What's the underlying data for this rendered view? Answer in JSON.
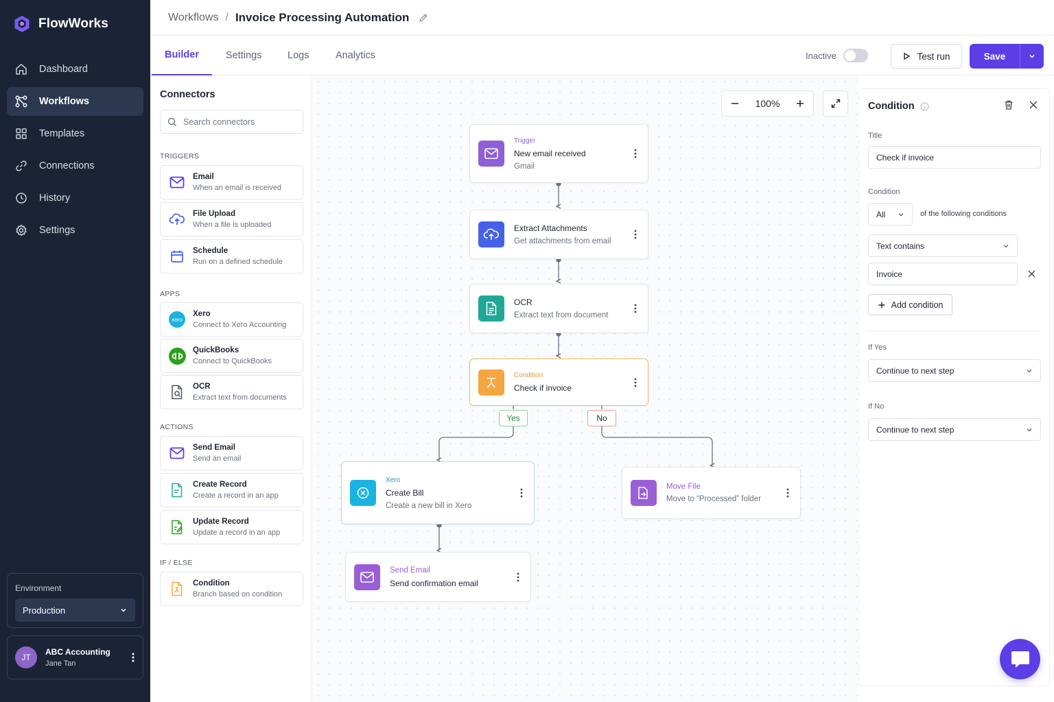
{
  "app": {
    "name": "FlowWorks"
  },
  "sidebar": {
    "items": [
      {
        "label": "Dashboard",
        "icon": "home-icon"
      },
      {
        "label": "Workflows",
        "icon": "workflow-icon",
        "active": true
      },
      {
        "label": "Templates",
        "icon": "grid-icon"
      },
      {
        "label": "Connections",
        "icon": "link-icon"
      },
      {
        "label": "History",
        "icon": "clock-icon"
      },
      {
        "label": "Settings",
        "icon": "gear-icon"
      }
    ],
    "environment": {
      "label": "Environment",
      "value": "Production"
    },
    "user": {
      "initials": "JT",
      "org": "ABC Accounting",
      "name": "Jane Tan"
    }
  },
  "header": {
    "breadcrumb_parent": "Workflows",
    "separator": "/",
    "title": "Invoice Processing Automation"
  },
  "tabs": [
    "Builder",
    "Settings",
    "Logs",
    "Analytics"
  ],
  "toolbar": {
    "status": "Inactive",
    "test_run": "Test run",
    "save": "Save"
  },
  "connectors": {
    "title": "Connectors",
    "search_placeholder": "Search connectors",
    "sections": {
      "triggers": "TRIGGERS",
      "apps": "APPS",
      "actions": "ACTIONS",
      "ifelse": "IF / ELSE"
    },
    "items": [
      {
        "name": "Email",
        "desc": "When an email is received",
        "icon": "mail-icon"
      },
      {
        "name": "File Upload",
        "desc": "When a file is uploaded",
        "icon": "cloud-upload-icon"
      },
      {
        "name": "Schedule",
        "desc": "Run on a defined schedule",
        "icon": "calendar-icon"
      },
      {
        "name": "Xero",
        "desc": "Connect to Xero Accounting",
        "icon": "xero-logo-icon",
        "logo_text": "xero"
      },
      {
        "name": "QuickBooks",
        "desc": "Connect to QuickBooks",
        "icon": "quickbooks-logo-icon"
      },
      {
        "name": "OCR",
        "desc": "Extract text from documents",
        "icon": "ocr-document-icon"
      },
      {
        "name": "Send Email",
        "desc": "Send an email",
        "icon": "mail-icon"
      },
      {
        "name": "Create Record",
        "desc": "Create a record in an app",
        "icon": "create-record-icon"
      },
      {
        "name": "Update Record",
        "desc": "Update a record in an app",
        "icon": "update-record-icon"
      },
      {
        "name": "Condition",
        "desc": "Branch based on condition",
        "icon": "condition-icon"
      }
    ]
  },
  "canvas": {
    "zoom": "100%",
    "nodes": [
      {
        "kicker": "Trigger",
        "title": "New email received",
        "sub": "Gmail"
      },
      {
        "title": "Extract Attachments",
        "sub": "Get attachments from email"
      },
      {
        "title": "OCR",
        "sub": "Extract text from document"
      },
      {
        "kicker": "Condition",
        "title": "Check if invoice"
      },
      {
        "kicker": "Xero",
        "title": "Create Bill",
        "sub": "Create a new bill in Xero"
      },
      {
        "kicker": "Move File",
        "sub": "Move to “Processed” folder"
      },
      {
        "kicker": "Send Email",
        "title": "Send confirmation email"
      }
    ],
    "branches": {
      "yes": "Yes",
      "no": "No"
    }
  },
  "props": {
    "title": "Condition",
    "title_label": "Title",
    "title_value": "Check if invoice",
    "condition_label": "Condition",
    "match_value": "All",
    "match_suffix": "of the following conditions",
    "operator": "Text contains",
    "value": "Invoice",
    "add_condition": "Add condition",
    "if_yes_label": "If Yes",
    "if_yes_value": "Continue to next step",
    "if_no_label": "If No",
    "if_no_value": "Continue to next step"
  },
  "colors": {
    "accent": "#5b3ee6",
    "sidebar_bg": "#1b2437",
    "trigger": "#8e5fd6",
    "action": "#4462e8",
    "ocr": "#1fa896",
    "condition": "#f4a641",
    "xero": "#19b3e2",
    "quickbooks": "#2ca01c"
  }
}
